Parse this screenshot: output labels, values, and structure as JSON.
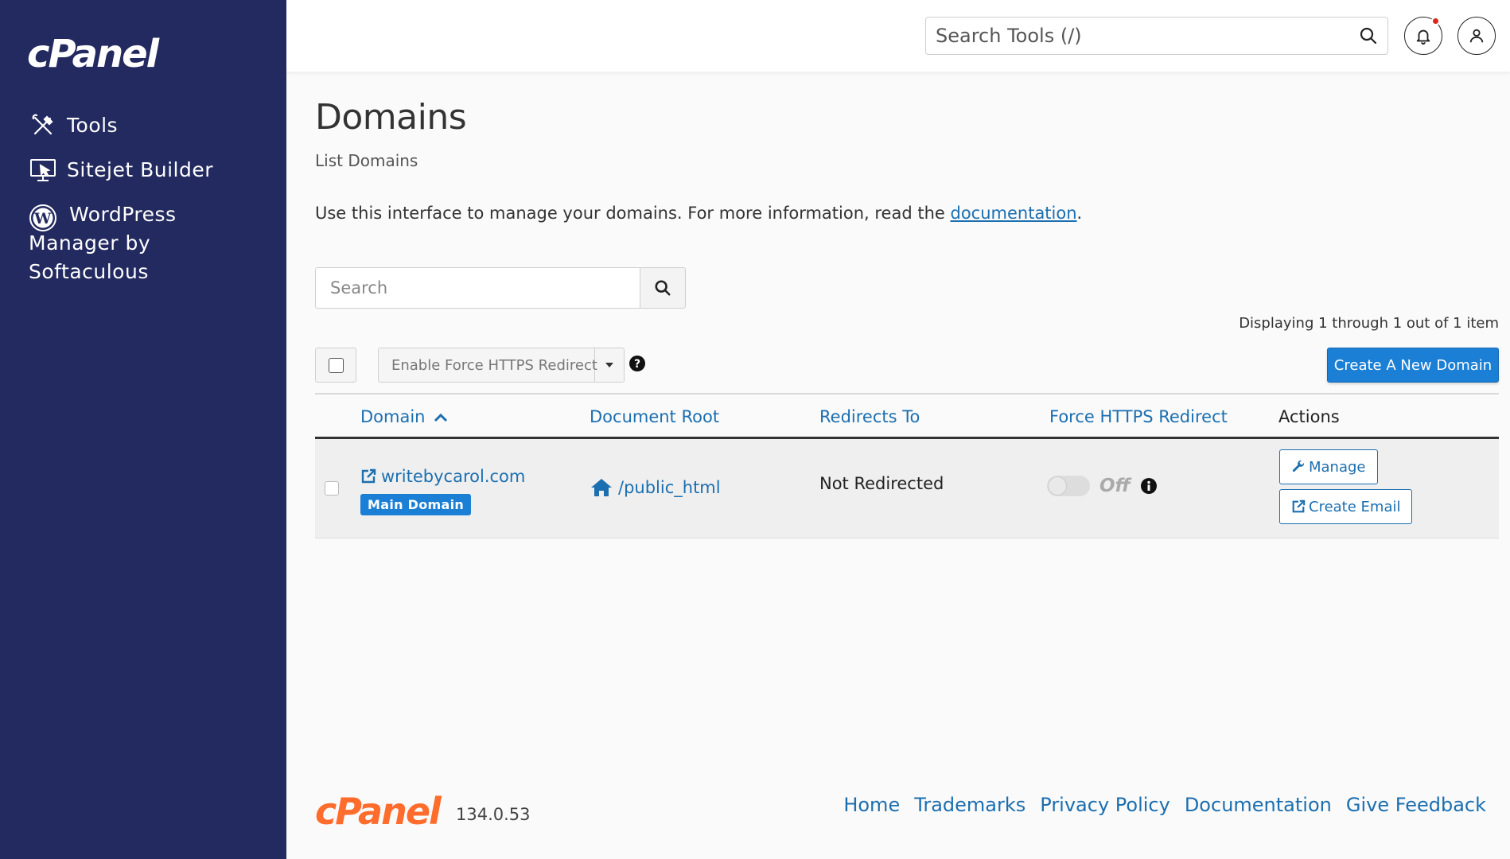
{
  "sidebar": {
    "brand": "cPanel",
    "items": [
      {
        "label": "Tools",
        "icon": "tools-icon"
      },
      {
        "label": "Sitejet Builder",
        "icon": "sitejet-icon"
      },
      {
        "label": "WordPress Manager by Softaculous",
        "icon": "wordpress-icon"
      }
    ]
  },
  "header": {
    "search_placeholder": "Search Tools (/)"
  },
  "page": {
    "title": "Domains",
    "subtitle": "List Domains",
    "intro_text": "Use this interface to manage your domains. For more information, read the ",
    "intro_link": "documentation",
    "intro_end": "."
  },
  "toolbar": {
    "search_placeholder": "Search",
    "displaying": "Displaying 1 through 1 out of 1 item",
    "bulk_action": "Enable Force HTTPS Redirect",
    "create_button": "Create A New Domain"
  },
  "table": {
    "columns": [
      "Domain",
      "Document Root",
      "Redirects To",
      "Force HTTPS Redirect",
      "Actions"
    ],
    "rows": [
      {
        "domain": "writebycarol.com",
        "badge": "Main Domain",
        "document_root": "/public_html",
        "redirects_to": "Not Redirected",
        "force_https": "Off",
        "actions": [
          "Manage",
          "Create Email"
        ]
      }
    ]
  },
  "footer": {
    "logo": "cPanel",
    "version": "134.0.53",
    "links": [
      "Home",
      "Trademarks",
      "Privacy Policy",
      "Documentation",
      "Give Feedback"
    ]
  },
  "colors": {
    "sidebar_bg": "#232a5f",
    "link": "#1b6fb0",
    "primary": "#1b7fd6",
    "footer_logo": "#ff6c2c",
    "notification_dot": "#e2231a"
  }
}
